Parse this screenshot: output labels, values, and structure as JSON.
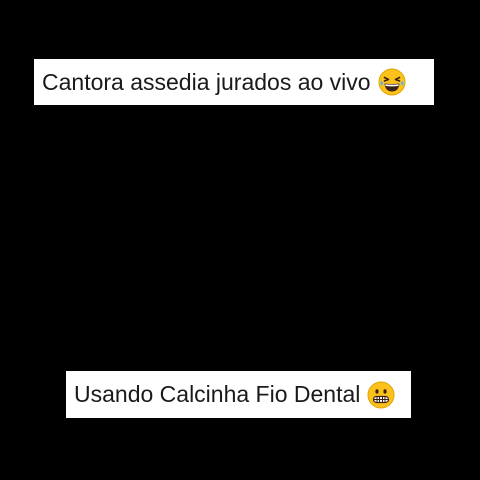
{
  "captions": {
    "top": {
      "text": "Cantora assedia jurados ao vivo",
      "emoji": "grinning-squinting-tears-of-joy-emoji"
    },
    "bottom": {
      "text": "Usando Calcinha Fio Dental",
      "emoji": "grimacing-face-emoji"
    }
  },
  "colors": {
    "background": "#000000",
    "caption_bg": "#ffffff",
    "caption_text": "#1a1a1a",
    "emoji_yellow": "#fcc21b"
  }
}
